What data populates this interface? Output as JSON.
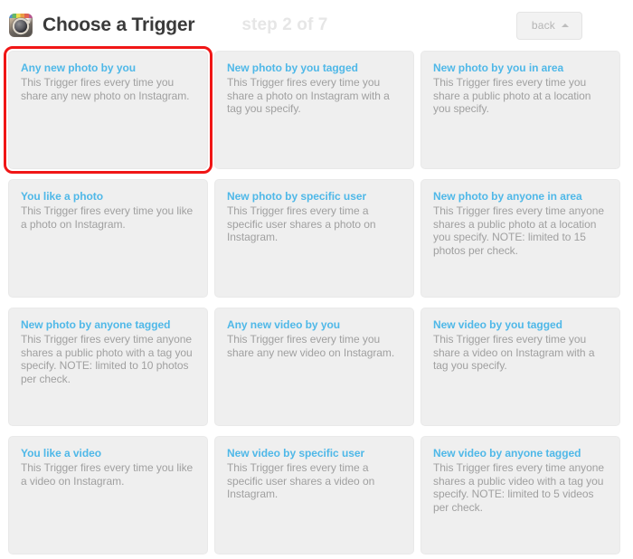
{
  "header": {
    "app_icon": "instagram-icon",
    "title": "Choose a Trigger",
    "step_label": "step 2 of 7",
    "back_label": "back",
    "back_caret_icon": "caret-up-icon"
  },
  "theme": {
    "accent_blue": "#4fb8e8",
    "selection_red": "#f01616",
    "card_bg": "#efefef",
    "desc_gray": "#a0a0a0",
    "title_dark": "#3a3a3a",
    "step_gray": "#e6e6e6",
    "page_bg": "#ffffff"
  },
  "triggers": [
    {
      "title": "Any new photo by you",
      "description": "This Trigger fires every time you share any new photo on Instagram.",
      "selected": true
    },
    {
      "title": "New photo by you tagged",
      "description": "This Trigger fires every time you share a photo on Instagram with a tag you specify.",
      "selected": false
    },
    {
      "title": "New photo by you in area",
      "description": "This Trigger fires every time you share a public photo at a location you specify.",
      "selected": false
    },
    {
      "title": "You like a photo",
      "description": "This Trigger fires every time you like a photo on Instagram.",
      "selected": false
    },
    {
      "title": "New photo by specific user",
      "description": "This Trigger fires every time a specific user shares a photo on Instagram.",
      "selected": false
    },
    {
      "title": "New photo by anyone in area",
      "description": "This Trigger fires every time anyone shares a public photo at a location you specify. NOTE: limited to 15 photos per check.",
      "selected": false
    },
    {
      "title": "New photo by anyone tagged",
      "description": "This Trigger fires every time anyone shares a public photo with a tag you specify. NOTE: limited to 10 photos per check.",
      "selected": false
    },
    {
      "title": "Any new video by you",
      "description": "This Trigger fires every time you share any new video on Instagram.",
      "selected": false
    },
    {
      "title": "New video by you tagged",
      "description": "This Trigger fires every time you share a video on Instagram with a tag you specify.",
      "selected": false
    },
    {
      "title": "You like a video",
      "description": "This Trigger fires every time you like a video on Instagram.",
      "selected": false
    },
    {
      "title": "New video by specific user",
      "description": "This Trigger fires every time a specific user shares a video on Instagram.",
      "selected": false
    },
    {
      "title": "New video by anyone tagged",
      "description": "This Trigger fires every time anyone shares a public video with a tag you specify. NOTE: limited to 5 videos per check.",
      "selected": false
    }
  ]
}
